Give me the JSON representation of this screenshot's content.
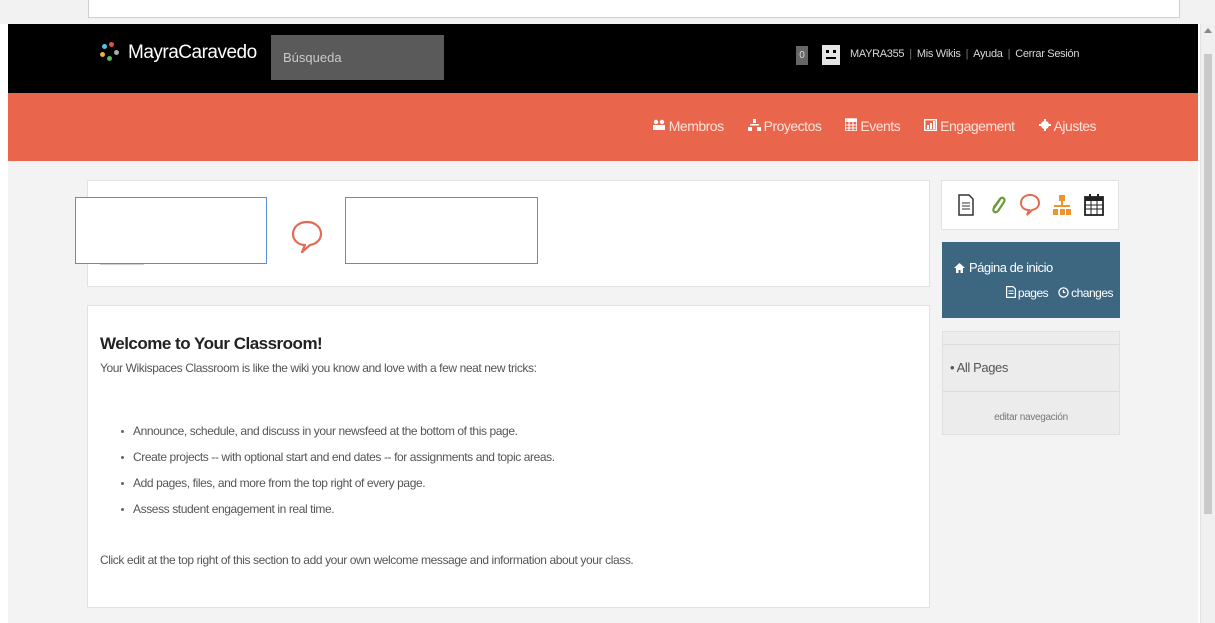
{
  "header": {
    "site_name": "MayraCaravedo",
    "search_placeholder": "Búsqueda",
    "notification_count": "0",
    "user_name": "MAYRA355",
    "links": [
      "Mis Wikis",
      "Ayuda",
      "Cerrar Sesión"
    ]
  },
  "nav": {
    "items": [
      {
        "icon": "members-icon",
        "label": "Membros"
      },
      {
        "icon": "projects-icon",
        "label": "Proyectos"
      },
      {
        "icon": "events-icon",
        "label": "Events"
      },
      {
        "icon": "engagement-icon",
        "label": "Engagement"
      },
      {
        "icon": "gear-icon",
        "label": "Ajustes"
      }
    ]
  },
  "welcome": {
    "title": "Welcome to Your Classroom!",
    "intro": "Your Wikispaces Classroom is like the wiki you know and love with a few neat new tricks:",
    "bullets": [
      "Announce, schedule, and discuss in your newsfeed at the bottom of this page.",
      "Create projects -- with optional start and end dates -- for assignments and topic areas.",
      "Add pages, files, and more from the top right of every page.",
      "Assess student engagement in real time."
    ],
    "footer": "Click edit at the top right of this section to add your own welcome message and information about your class."
  },
  "sidebar": {
    "home_title": "Página de inicio",
    "pages_link": "pages",
    "changes_link": "changes",
    "all_pages": "All Pages",
    "edit_nav": "editar navegación"
  },
  "colors": {
    "topbar": "#000000",
    "accent": "#e9664c",
    "home_panel": "#3d6681"
  }
}
